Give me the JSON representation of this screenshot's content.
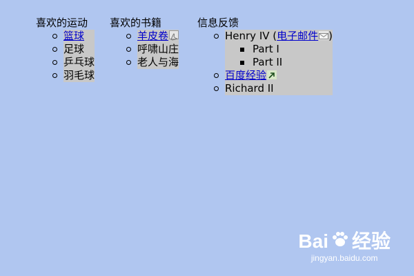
{
  "columns": {
    "sports": {
      "title": "喜欢的运动",
      "items": [
        "篮球",
        "足球",
        "乒乓球",
        "羽毛球"
      ]
    },
    "books": {
      "title": "喜欢的书籍",
      "items": [
        "羊皮卷",
        "呼啸山庄",
        "老人与海"
      ]
    },
    "feedback": {
      "title": "信息反馈",
      "henry_prefix": "Henry IV (",
      "email_link": "电子邮件",
      "henry_suffix": ")",
      "parts": [
        "Part I",
        "Part II"
      ],
      "baidu_link": "百度经验",
      "richard": "Richard II"
    }
  },
  "icons": {
    "pdf": "pdf-icon",
    "email": "mail-icon",
    "external": "external-link-icon"
  },
  "watermark": {
    "logo_text": "Bai",
    "logo_suffix": "经验",
    "url": "jingyan.baidu.com"
  },
  "colors": {
    "background": "#b0c6f0",
    "list_background": "#c8c8c8",
    "link": "#0000cc"
  }
}
